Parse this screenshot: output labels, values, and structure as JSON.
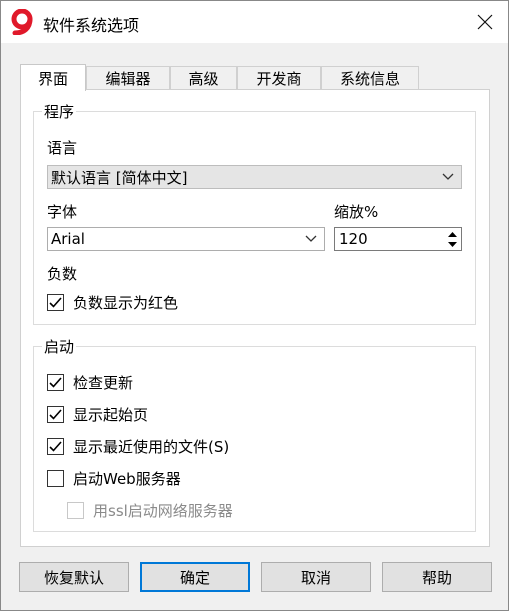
{
  "window": {
    "title": "软件系统选项"
  },
  "tabs": [
    {
      "label": "界面"
    },
    {
      "label": "编辑器"
    },
    {
      "label": "高级"
    },
    {
      "label": "开发商"
    },
    {
      "label": "系统信息"
    }
  ],
  "program": {
    "group_label": "程序",
    "language_label": "语言",
    "language_value": "默认语言 [简体中文]",
    "font_label": "字体",
    "font_value": "Arial",
    "zoom_label": "缩放%",
    "zoom_value": "120",
    "negative_label": "负数",
    "negative_red": {
      "label": "负数显示为红色",
      "checked": true
    }
  },
  "startup": {
    "group_label": "启动",
    "check_updates": {
      "label": "检查更新",
      "checked": true
    },
    "show_start_page": {
      "label": "显示起始页",
      "checked": true
    },
    "show_recent_files": {
      "label": "显示最近使用的文件(S)",
      "checked": true
    },
    "start_web_server": {
      "label": "启动Web服务器",
      "checked": false
    },
    "use_ssl": {
      "label": "用ssl启动网络服务器",
      "checked": false,
      "disabled": true
    }
  },
  "buttons": {
    "restore_defaults": "恢复默认",
    "ok": "确定",
    "cancel": "取消",
    "help": "帮助"
  },
  "colors": {
    "default_button_border": "#0078d7",
    "app_icon": "#e0192a"
  }
}
